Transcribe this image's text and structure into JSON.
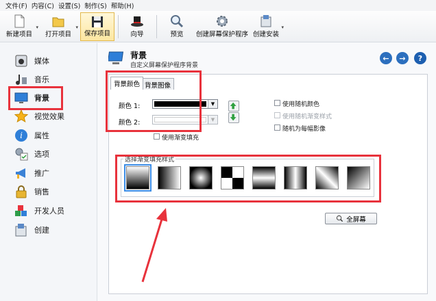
{
  "menu": [
    "文件(F)",
    "内容(C)",
    "设置(S)",
    "制作(S)",
    "帮助(H)"
  ],
  "toolbar": {
    "new": "新建项目",
    "open": "打开项目",
    "save": "保存项目",
    "wizard": "向导",
    "preview": "预览",
    "create_ss": "创建屏幕保护程序",
    "create_setup": "创建安装"
  },
  "sidebar": {
    "items": [
      {
        "label": "媒体",
        "icon": "speaker-icon"
      },
      {
        "label": "音乐",
        "icon": "music-icon"
      },
      {
        "label": "背景",
        "icon": "monitor-icon"
      },
      {
        "label": "视觉效果",
        "icon": "star-icon"
      },
      {
        "label": "属性",
        "icon": "info-icon"
      },
      {
        "label": "选项",
        "icon": "options-icon"
      },
      {
        "label": "推广",
        "icon": "megaphone-icon"
      },
      {
        "label": "销售",
        "icon": "lock-icon"
      },
      {
        "label": "开发人员",
        "icon": "blocks-icon"
      },
      {
        "label": "创建",
        "icon": "installer-icon"
      }
    ]
  },
  "header": {
    "title": "背景",
    "subtitle": "自定义屏幕保护程序背景"
  },
  "tabs": [
    {
      "label": "背景颜色"
    },
    {
      "label": "背景图像"
    }
  ],
  "color": {
    "label1": "颜色 1:",
    "label2": "颜色 2:",
    "color1": "#000000",
    "color2": "#ffffff",
    "gradient_fill": "使用渐变填充"
  },
  "options": {
    "random_color": "使用随机颜色",
    "random_gradient": "使用随机渐变样式",
    "random_per_image": "随机为每幅影像"
  },
  "gradient_group_label": "选择渐变填充样式",
  "fullscreen_button": "全屏幕",
  "colors": {
    "accent_red": "#e8323c",
    "selection_blue": "#3c8de6"
  }
}
